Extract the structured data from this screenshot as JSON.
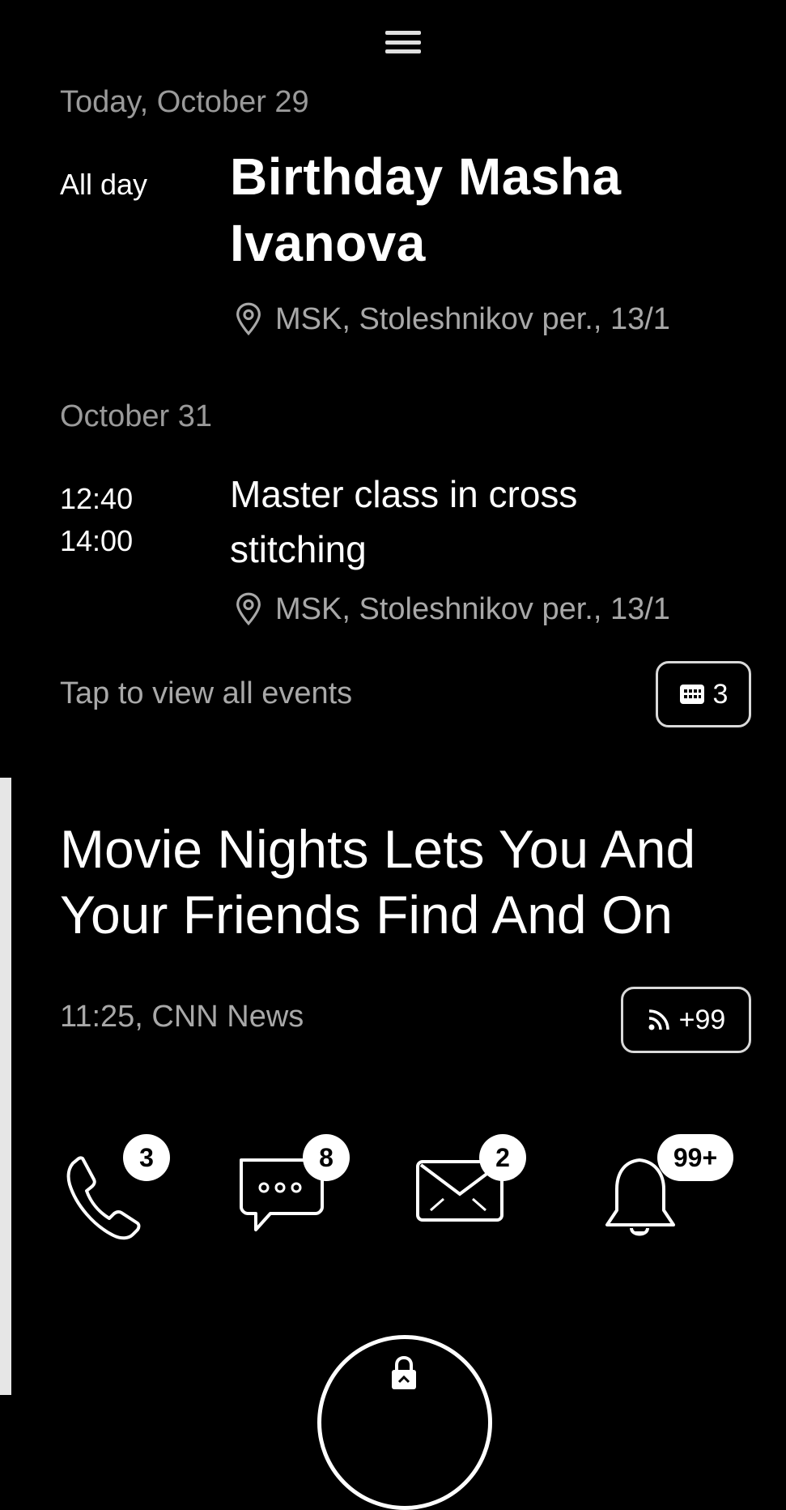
{
  "agenda": {
    "today_header": "Today, October 29",
    "events_today": [
      {
        "time": "All day",
        "title_line1": "Birthday Masha",
        "title_line2": "Ivanova",
        "location": "MSK, Stoleshnikov per., 13/1"
      }
    ],
    "second_header": "October 31",
    "events_second": [
      {
        "start": "12:40",
        "end": "14:00",
        "title_line1": "Master class in cross",
        "title_line2": "stitching",
        "location": "MSK, Stoleshnikov per., 13/1"
      }
    ],
    "tap_hint": "Tap to view all events",
    "events_count": "3"
  },
  "news": {
    "headline_line1": "Movie Nights Lets You And",
    "headline_line2": "Your Friends Find And On",
    "meta": "11:25, CNN News",
    "feed_count": "+99"
  },
  "notifications": {
    "calls": "3",
    "messages": "8",
    "mail": "2",
    "alerts": "99+"
  },
  "icons": [
    "menu-icon",
    "location-pin-icon",
    "calendar-icon",
    "rss-icon",
    "phone-icon",
    "chat-icon",
    "mail-icon",
    "bell-icon",
    "lock-icon"
  ]
}
